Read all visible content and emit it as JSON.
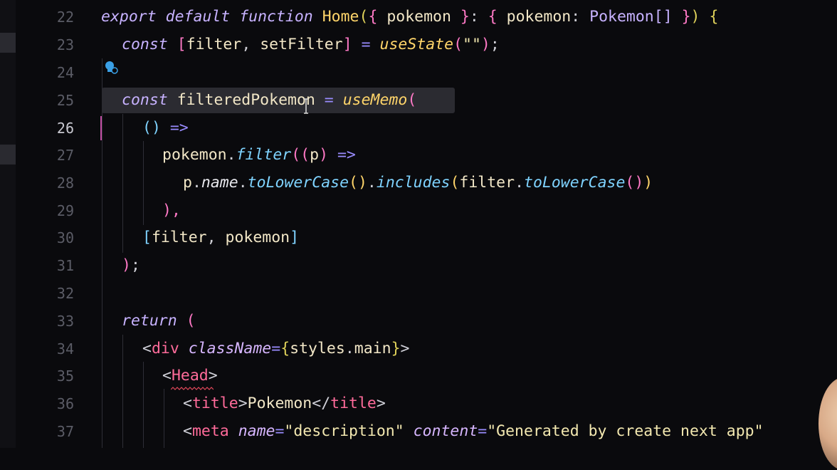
{
  "editor": {
    "line_numbers": [
      "22",
      "23",
      "24",
      "25",
      "26",
      "27",
      "28",
      "29",
      "30",
      "31",
      "32",
      "33",
      "34",
      "35",
      "36",
      "37"
    ],
    "active_line": "26"
  },
  "code": {
    "l22": [
      "export",
      "default",
      "function",
      "Home",
      "(",
      "{",
      " pokemon ",
      "}",
      ": ",
      "{",
      " pokemon",
      ": ",
      "Pokemon",
      "[]",
      " ",
      "}",
      ")",
      " {"
    ],
    "l23": [
      "const",
      "[",
      "filter",
      ", ",
      "setFilter",
      "]",
      " = ",
      "useState",
      "(",
      "\"\"",
      ")",
      ";"
    ],
    "l25": [
      "const",
      "filteredPokemon",
      " = ",
      "useMemo",
      "("
    ],
    "l26": [
      "()",
      " =>"
    ],
    "l27": [
      "pokemon",
      ".",
      "filter",
      "((",
      "p",
      ")",
      " =>"
    ],
    "l28": [
      "p",
      ".",
      "name",
      ".",
      "toLowerCase",
      "()",
      ".",
      "includes",
      "(",
      "filter",
      ".",
      "toLowerCase",
      "()",
      ")"
    ],
    "l29": [
      "),"
    ],
    "l30": [
      "[",
      "filter",
      ", ",
      "pokemon",
      "]"
    ],
    "l31": [
      ")",
      ";"
    ],
    "l33": [
      "return",
      " ("
    ],
    "l34": [
      "<",
      "div",
      " ",
      "className",
      "=",
      "{",
      "styles",
      ".",
      "main",
      "}",
      ">"
    ],
    "l35": [
      "<",
      "Head",
      ">"
    ],
    "l36": [
      "<",
      "title",
      ">",
      "Pokemon",
      "</",
      "title",
      ">"
    ],
    "l37": [
      "<",
      "meta",
      " ",
      "name",
      "=",
      "\"description\"",
      " ",
      "content",
      "=",
      "\"Generated by create next app\""
    ]
  },
  "colors": {
    "background": "#0a0a0d",
    "keyword": "#c7b2ff",
    "function": "#ffd56a",
    "tag": "#ff6b9a",
    "method": "#7fd3ff",
    "active_line_marker": "#c34fa5"
  },
  "icons": {
    "lightbulb": "lightbulb-icon",
    "cursor": "ibeam-cursor-icon",
    "error": "error-squiggle"
  }
}
